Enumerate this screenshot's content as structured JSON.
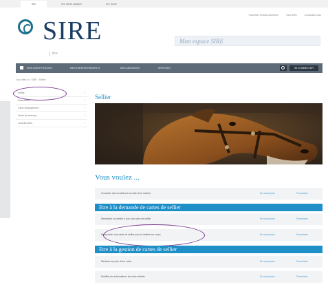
{
  "topbar": {
    "tabs": [
      {
        "label": "Ifce",
        "active": true
      },
      {
        "label": "Ifce Santé publique",
        "active": false
      },
      {
        "label": "Ifce Santé",
        "active": false
      }
    ]
  },
  "header": {
    "links": [
      "Vous êtes vendeur/acheteur",
      "Vous êtes",
      "Contactez-nous"
    ],
    "logo_text": "SIRE",
    "logo_sub": "ifce",
    "espace_placeholder": "Mon espace SIRE"
  },
  "nav": {
    "items": [
      "MON IDENTIFICATION",
      "MES ENREGISTREMENTS",
      "MES ANNONCES",
      "SERVICES"
    ],
    "login_label": "SE CONNECTER"
  },
  "breadcrumb": "Vous êtes ici : SIRE › Sellier",
  "sidebar": {
    "items": [
      "Sellier",
      "Détenteurs",
      "Carte d'équipement",
      "Vente de chevaux",
      "Coordonnées"
    ]
  },
  "main": {
    "title": "Sellier",
    "vous_title": "Vous voulez ...",
    "rows_top": [
      {
        "text": "Consulter les formalités à la suite de la sellerie",
        "voir": "En savoir plus",
        "dl": "Formulaire"
      }
    ],
    "section1": "Etre à la demande de cartes de sellier",
    "rows_mid": [
      {
        "text": "Demander ou mettre à jour une carte de sellier",
        "voir": "En savoir plus",
        "dl": "Formulaire"
      },
      {
        "text": "Renouveler une carte de sellier pour la sellerie en cours",
        "voir": "En savoir plus",
        "dl": "Formulaire"
      }
    ],
    "section2": "Etre à la gestion de cartes de sellier",
    "rows_bottom": [
      {
        "text": "Déclarer la perte d'une carte",
        "voir": "En savoir plus",
        "dl": "Formulaire"
      },
      {
        "text": "Modifier les informations de votre sellerie",
        "voir": "En savoir plus",
        "dl": "Formulaire"
      }
    ]
  },
  "colors": {
    "brand": "#1a3d63",
    "accent": "#1f8fc8",
    "nav": "#5d6b78",
    "highlight": "#7b3a8e"
  }
}
